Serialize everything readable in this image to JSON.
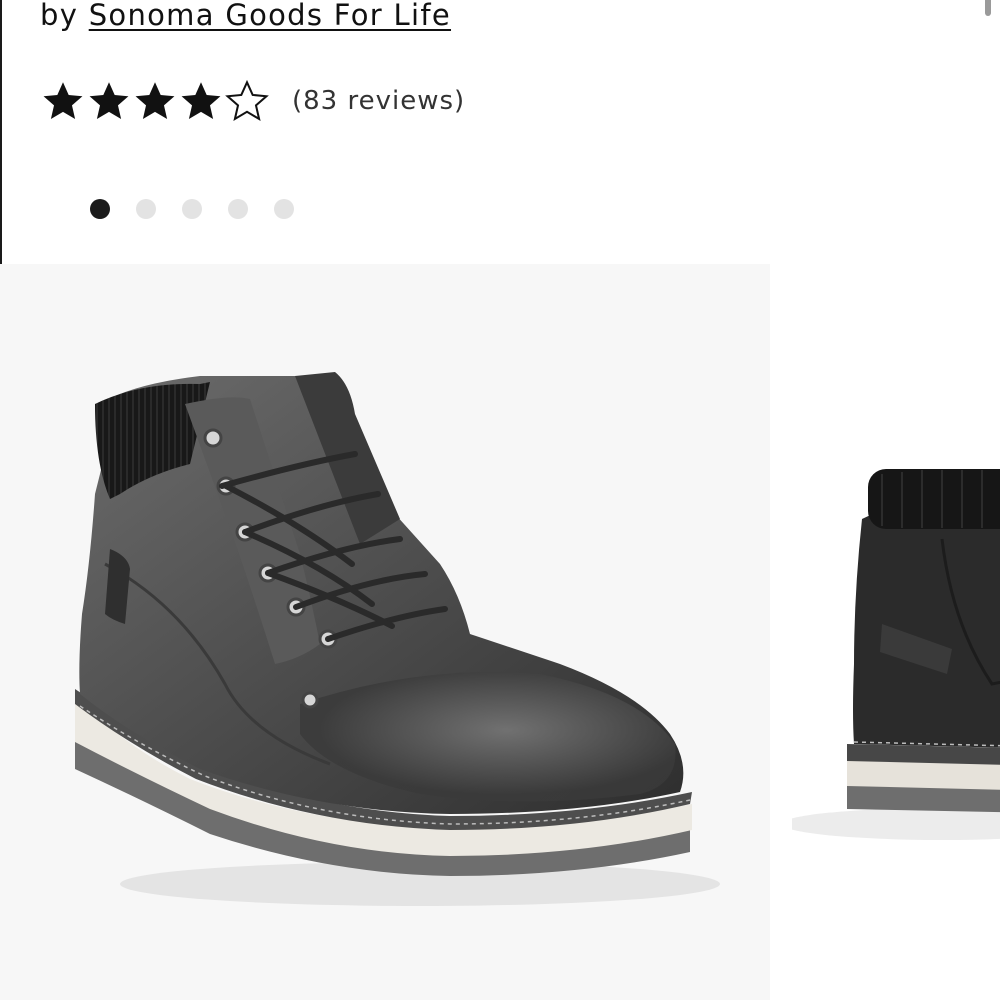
{
  "product": {
    "byline_prefix": "by",
    "brand": "Sonoma Goods For Life",
    "rating": 4.5,
    "rating_max": 5,
    "reviews_text": "(83 reviews)"
  },
  "carousel": {
    "total_slides": 5,
    "active_index": 0,
    "slides": [
      {
        "image": "dark gray leather lace-up ankle boot with knit collar and white sole"
      },
      {
        "image": "black leather ankle boot, side view (partially visible)"
      }
    ]
  },
  "colors": {
    "text": "#111111",
    "dot_active": "#1b1b1b",
    "dot_inactive": "#e3e3e3",
    "image_bg": "#f7f7f7"
  }
}
